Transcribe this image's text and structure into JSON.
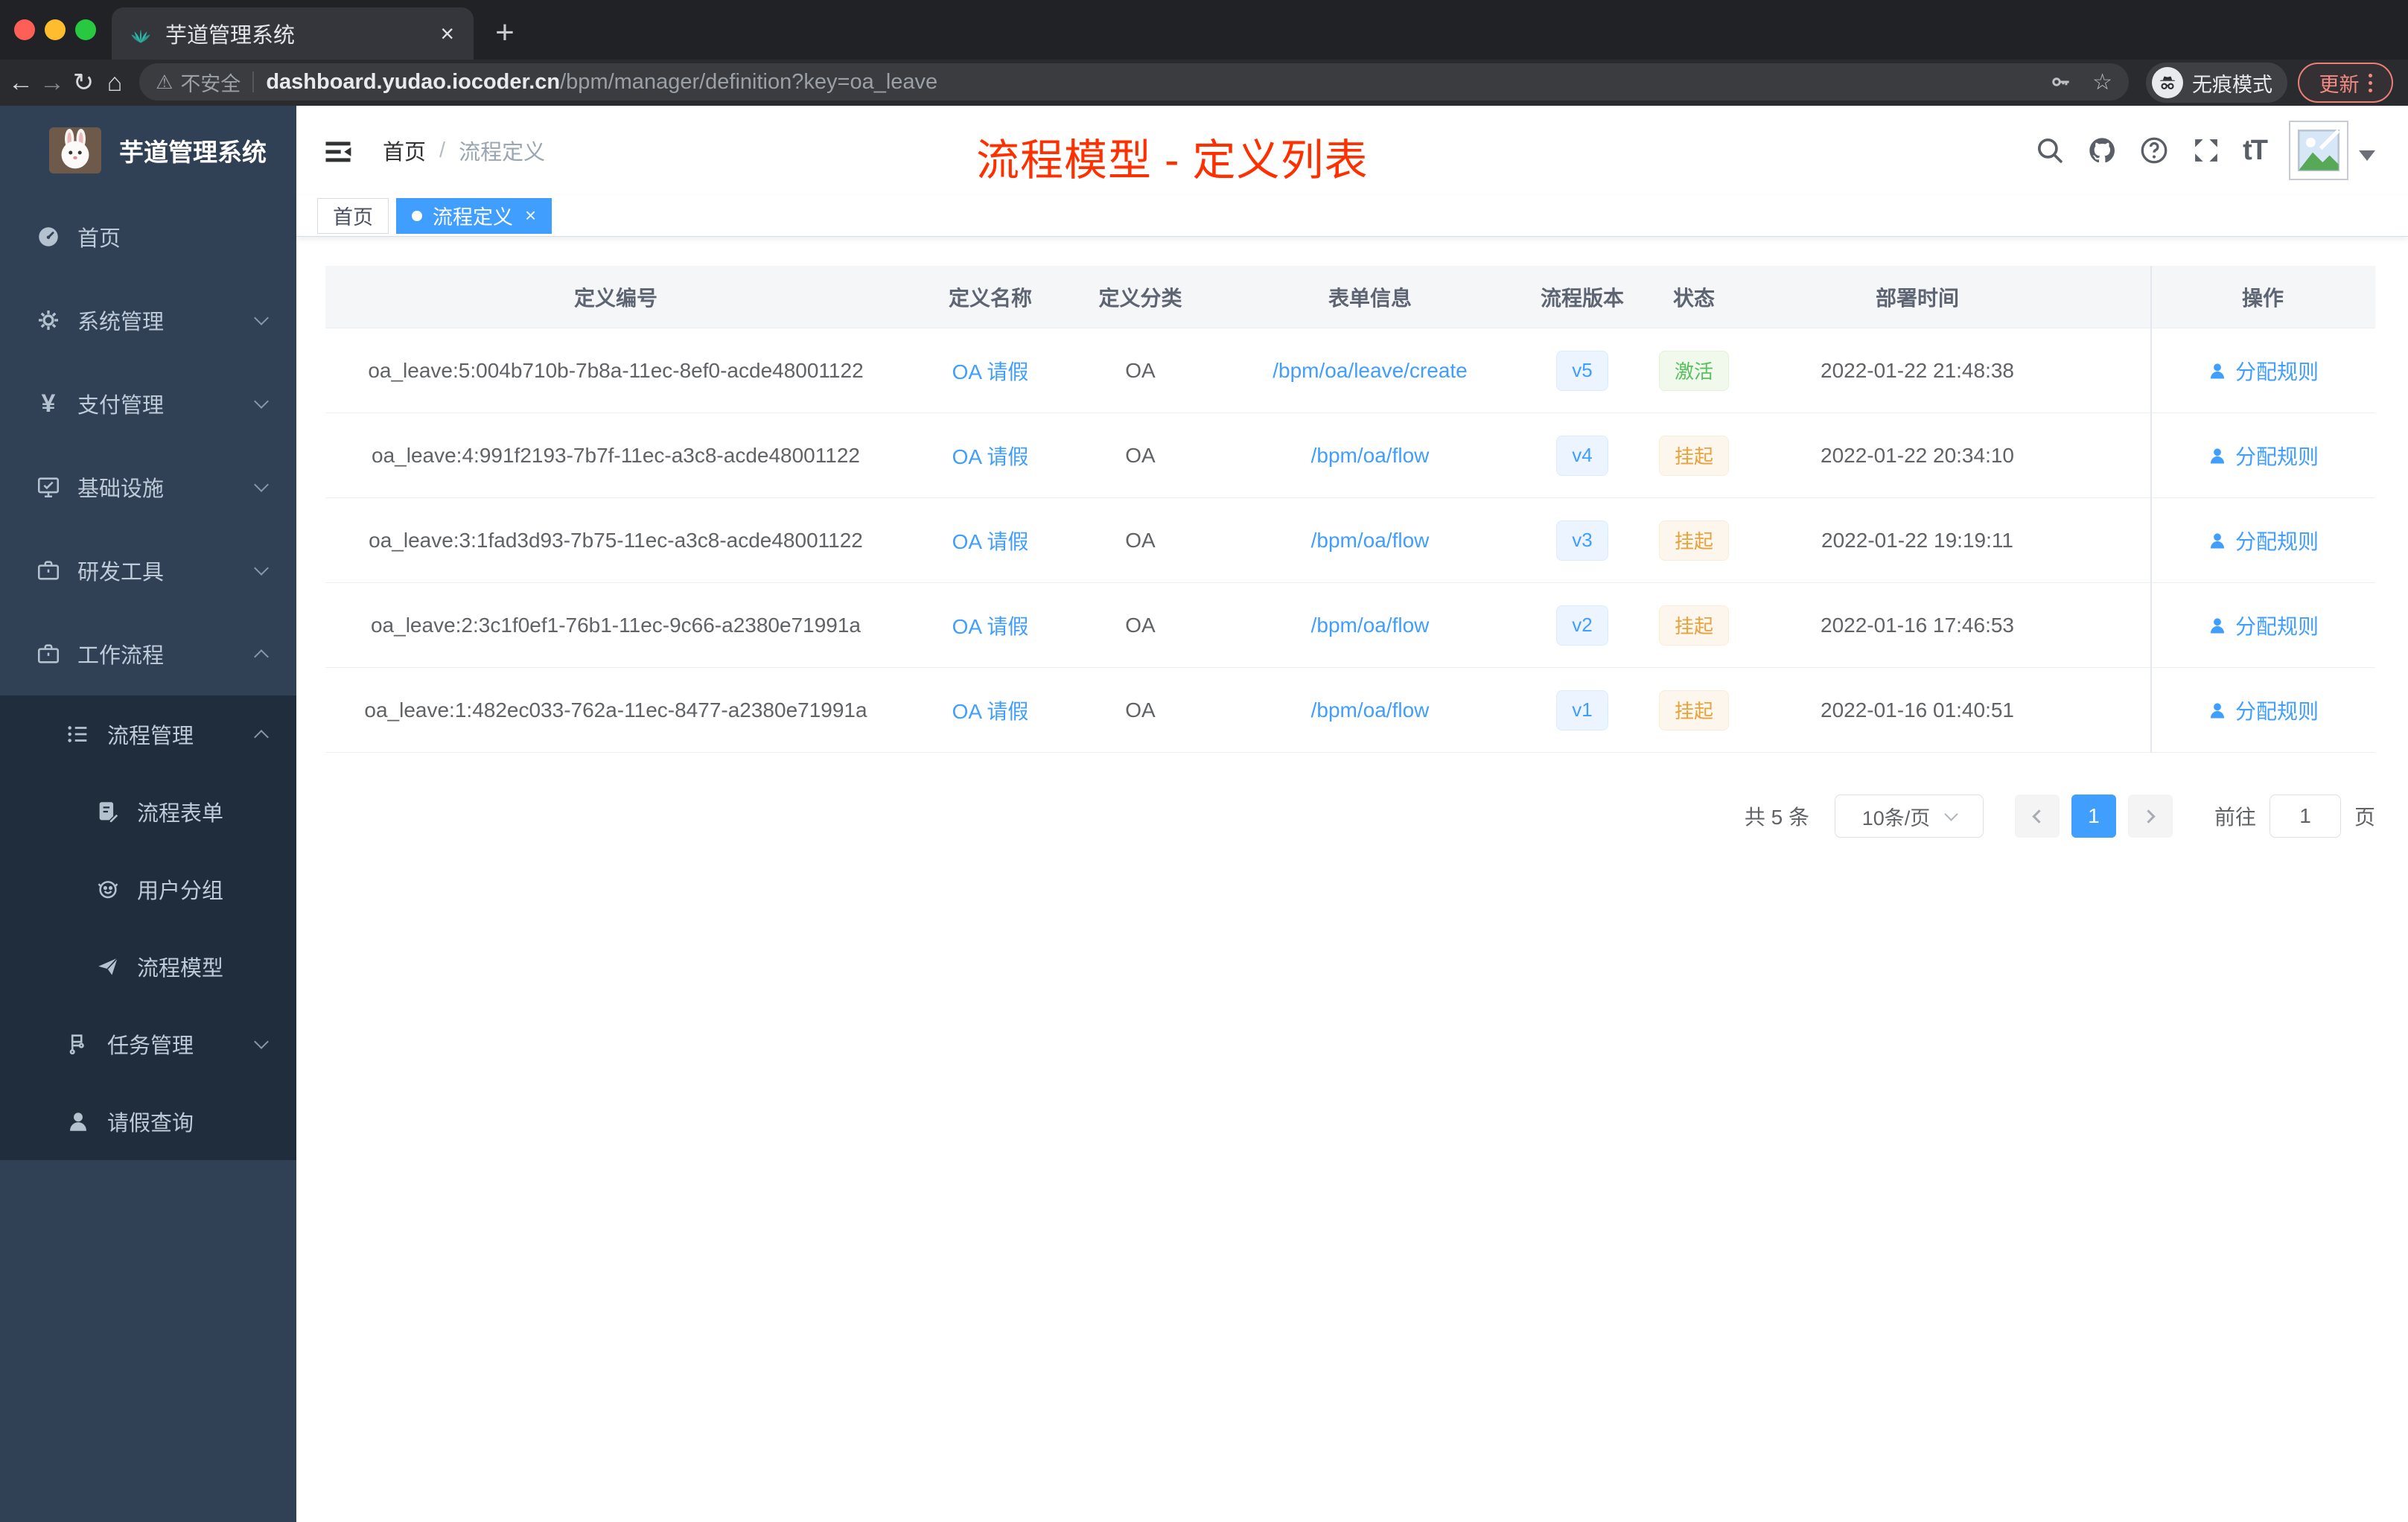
{
  "browser": {
    "tab": {
      "title": "芋道管理系统",
      "close": "×",
      "new_tab": "+"
    },
    "nav": {
      "back": "←",
      "forward": "→",
      "reload": "↻",
      "home": "⌂"
    },
    "address": {
      "warning_icon": "⚠",
      "warning": "不安全",
      "host": "dashboard.yudao.iocoder.cn",
      "path": "/bpm/manager/definition?key=oa_leave"
    },
    "incognito_label": "无痕模式",
    "update_label": "更新"
  },
  "annotation": {
    "title": "流程模型 - 定义列表",
    "color": "#ff3000"
  },
  "sidebar": {
    "logo_title": "芋道管理系统",
    "menu": [
      {
        "label": "首页",
        "icon": "dashboard-icon",
        "level": 1,
        "chevron": null,
        "dark": false
      },
      {
        "label": "系统管理",
        "icon": "gear-icon",
        "level": 1,
        "chevron": "down",
        "dark": false
      },
      {
        "label": "支付管理",
        "icon": "yen-icon",
        "level": 1,
        "chevron": "down",
        "dark": false
      },
      {
        "label": "基础设施",
        "icon": "monitor-icon",
        "level": 1,
        "chevron": "down",
        "dark": false
      },
      {
        "label": "研发工具",
        "icon": "briefcase-icon",
        "level": 1,
        "chevron": "down",
        "dark": false
      },
      {
        "label": "工作流程",
        "icon": "briefcase-icon",
        "level": 1,
        "chevron": "up",
        "dark": false
      },
      {
        "label": "流程管理",
        "icon": "list-icon",
        "level": 2,
        "chevron": "up",
        "dark": true
      },
      {
        "label": "流程表单",
        "icon": "form-icon",
        "level": 3,
        "chevron": null,
        "dark": true
      },
      {
        "label": "用户分组",
        "icon": "user-group-icon",
        "level": 3,
        "chevron": null,
        "dark": true
      },
      {
        "label": "流程模型",
        "icon": "paper-plane-icon",
        "level": 3,
        "chevron": null,
        "dark": true
      },
      {
        "label": "任务管理",
        "icon": "flow-icon",
        "level": 2,
        "chevron": "down",
        "dark": true
      },
      {
        "label": "请假查询",
        "icon": "person-icon",
        "level": 2,
        "chevron": null,
        "dark": true
      }
    ]
  },
  "header": {
    "breadcrumb_home": "首页",
    "breadcrumb_sep": "/",
    "breadcrumb_current": "流程定义",
    "fontsize_icon_label": "tT"
  },
  "tags": {
    "home": "首页",
    "active": "流程定义",
    "active_close": "×"
  },
  "table": {
    "columns": [
      "定义编号",
      "定义名称",
      "定义分类",
      "表单信息",
      "流程版本",
      "状态",
      "部署时间",
      "操作"
    ],
    "rows": [
      {
        "id": "oa_leave:5:004b710b-7b8a-11ec-8ef0-acde48001122",
        "name": "OA 请假",
        "category": "OA",
        "form": "/bpm/oa/leave/create",
        "version": "v5",
        "status": "激活",
        "status_type": "success",
        "time": "2022-01-22 21:48:38",
        "action": "分配规则"
      },
      {
        "id": "oa_leave:4:991f2193-7b7f-11ec-a3c8-acde48001122",
        "name": "OA 请假",
        "category": "OA",
        "form": "/bpm/oa/flow",
        "version": "v4",
        "status": "挂起",
        "status_type": "warning",
        "time": "2022-01-22 20:34:10",
        "action": "分配规则"
      },
      {
        "id": "oa_leave:3:1fad3d93-7b75-11ec-a3c8-acde48001122",
        "name": "OA 请假",
        "category": "OA",
        "form": "/bpm/oa/flow",
        "version": "v3",
        "status": "挂起",
        "status_type": "warning",
        "time": "2022-01-22 19:19:11",
        "action": "分配规则"
      },
      {
        "id": "oa_leave:2:3c1f0ef1-76b1-11ec-9c66-a2380e71991a",
        "name": "OA 请假",
        "category": "OA",
        "form": "/bpm/oa/flow",
        "version": "v2",
        "status": "挂起",
        "status_type": "warning",
        "time": "2022-01-16 17:46:53",
        "action": "分配规则"
      },
      {
        "id": "oa_leave:1:482ec033-762a-11ec-8477-a2380e71991a",
        "name": "OA 请假",
        "category": "OA",
        "form": "/bpm/oa/flow",
        "version": "v1",
        "status": "挂起",
        "status_type": "warning",
        "time": "2022-01-16 01:40:51",
        "action": "分配规则"
      }
    ]
  },
  "pagination": {
    "total": "共 5 条",
    "page_size": "10条/页",
    "current": "1",
    "goto_label": "前往",
    "goto_value": "1",
    "goto_unit": "页"
  },
  "colors": {
    "accent": "#409eff",
    "success": "#58c05e",
    "warning": "#e6a23c",
    "sidebar_bg": "#304156",
    "sidebar_sub_bg": "#1f2d3d",
    "annotation": "#ff3000"
  }
}
